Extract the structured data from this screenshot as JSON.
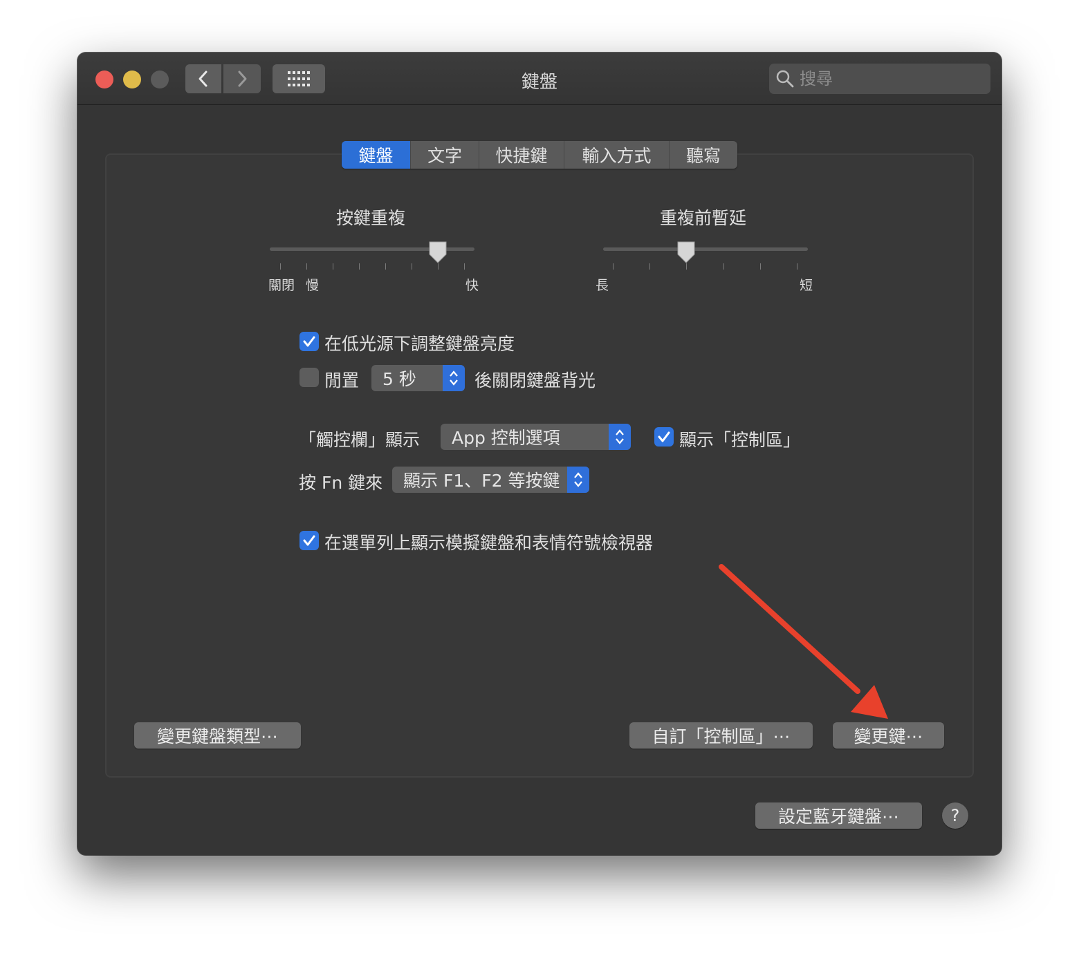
{
  "window": {
    "title": "鍵盤"
  },
  "search": {
    "placeholder": "搜尋"
  },
  "icons": {
    "back": "chevron-left-icon",
    "forward": "chevron-right-icon",
    "grid": "grid-icon",
    "search": "search-icon"
  },
  "tabs": [
    {
      "label": "鍵盤",
      "active": true
    },
    {
      "label": "文字",
      "active": false
    },
    {
      "label": "快捷鍵",
      "active": false
    },
    {
      "label": "輸入方式",
      "active": false
    },
    {
      "label": "聽寫",
      "active": false
    }
  ],
  "key_repeat": {
    "title": "按鍵重複",
    "min_label_off": "關閉",
    "min_label_slow": "慢",
    "max_label": "快"
  },
  "repeat_delay": {
    "title": "重複前暫延",
    "min_label": "長",
    "max_label": "短"
  },
  "options": {
    "adjust_brightness": {
      "label": "在低光源下調整鍵盤亮度",
      "checked": true
    },
    "idle": {
      "label_before": "閒置",
      "value": "5 秒",
      "label_after": "後關閉鍵盤背光",
      "checked": false
    },
    "touchbar": {
      "label": "「觸控欄」顯示",
      "value": "App 控制選項"
    },
    "show_control_strip": {
      "label": "顯示「控制區」",
      "checked": true
    },
    "fn_key": {
      "label": "按 Fn 鍵來",
      "value": "顯示 F1、F2 等按鍵"
    },
    "show_viewer": {
      "label": "在選單列上顯示模擬鍵盤和表情符號檢視器",
      "checked": true
    }
  },
  "buttons": {
    "change_keyboard_type": "變更鍵盤類型⋯",
    "customize_control_strip": "自訂「控制區」⋯",
    "modifier_keys": "變更鍵⋯",
    "bluetooth_keyboard": "設定藍牙鍵盤⋯",
    "help": "?"
  },
  "colors": {
    "accent": "#2f74e0",
    "annotation_arrow": "#e8412c"
  }
}
